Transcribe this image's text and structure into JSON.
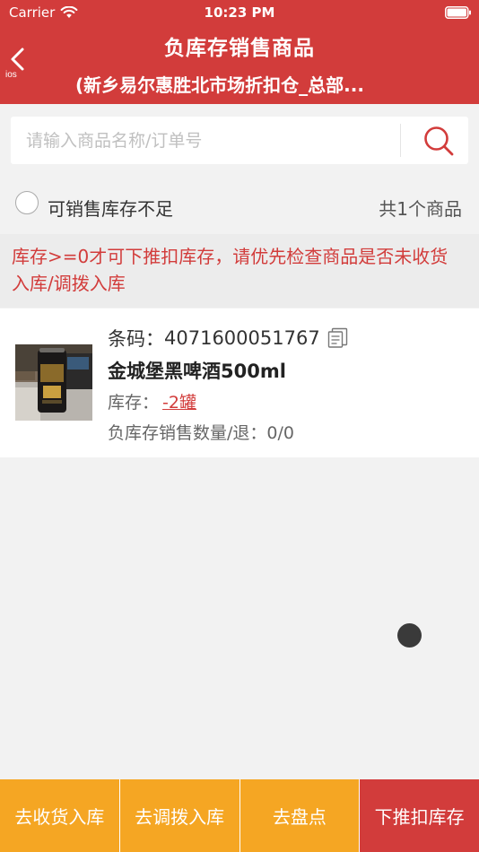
{
  "status_bar": {
    "carrier": "Carrier",
    "time": "10:23 PM"
  },
  "nav": {
    "back_sub_label": "ios",
    "title": "负库存销售商品",
    "subtitle": "(新乡易尔惠胜北市场折扣仓_总部..."
  },
  "search": {
    "placeholder": "请输入商品名称/订单号",
    "value": ""
  },
  "filter": {
    "checkbox_label": "可销售库存不足",
    "checked": false,
    "count_text": "共1个商品"
  },
  "warning": {
    "text": "库存>=0才可下推扣库存，请优先检查商品是否未收货入库/调拨入库"
  },
  "products": [
    {
      "barcode_label": "条码：",
      "barcode": "4071600051767",
      "name": "金城堡黑啤酒500ml",
      "stock_label": "库存：",
      "stock_value": "-2罐",
      "neg_sales_label": "负库存销售数量/退：",
      "neg_sales_value": "0/0"
    }
  ],
  "bottom_bar": {
    "receive_label": "去收货入库",
    "transfer_label": "去调拨入库",
    "stocktake_label": "去盘点",
    "deduct_label": "下推扣库存"
  },
  "colors": {
    "primary_red": "#d23c3b",
    "secondary_orange": "#f5a623",
    "background": "#f2f2f2"
  },
  "icons": {
    "back": "chevron-left-icon",
    "search": "search-icon",
    "copy": "copy-icon",
    "wifi": "wifi-icon",
    "battery": "battery-icon"
  }
}
